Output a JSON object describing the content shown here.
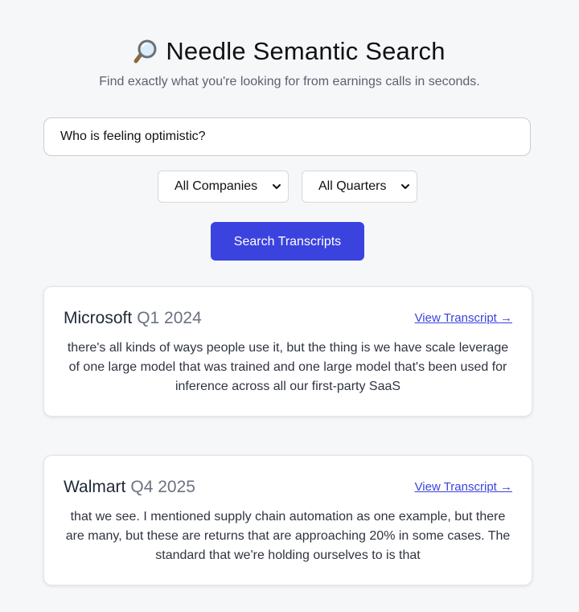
{
  "header": {
    "title": "Needle Semantic Search",
    "icon": "magnifying-glass-icon",
    "subtitle": "Find exactly what you're looking for from earnings calls in seconds."
  },
  "search": {
    "value": "Who is feeling optimistic?",
    "placeholder": ""
  },
  "filters": {
    "company_selected": "All Companies",
    "quarter_selected": "All Quarters"
  },
  "search_button": {
    "label": "Search Transcripts"
  },
  "colors": {
    "accent": "#3b43df",
    "background": "#f6f7f9"
  },
  "results": [
    {
      "company": "Microsoft",
      "quarter": "Q1 2024",
      "link_label": "View Transcript →",
      "snippet": "there's all kinds of ways people use it, but the thing is we have scale leverage of one large model that was trained and one large model that's been used for inference across all our first-party SaaS"
    },
    {
      "company": "Walmart",
      "quarter": "Q4 2025",
      "link_label": "View Transcript →",
      "snippet": "that we see. I mentioned supply chain automation as one example, but there are many, but these are returns that are approaching 20% in some cases. The standard that we're holding ourselves to is that"
    }
  ]
}
